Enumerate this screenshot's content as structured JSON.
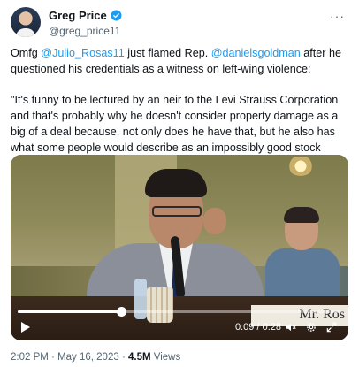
{
  "author": {
    "display_name": "Greg Price",
    "handle": "@greg_price11",
    "verified": true,
    "more_icon": "more-dots-icon"
  },
  "tweet": {
    "part1_prefix": "Omfg ",
    "mention1": "@Julio_Rosas11",
    "part1_middle": " just flamed Rep. ",
    "mention2": "@danielsgoldman",
    "part1_suffix": " after he questioned his credentials as a witness on left-wing violence:",
    "quote": "\"It's funny to be lectured by an heir to the Levi Strauss Corporation and that's probably why he doesn't consider property damage as a big of a deal because, not only does he have that, but he also has what some people would describe as an impossibly good stock portfolio.\""
  },
  "video": {
    "placard_text": "Mr. Ros",
    "time_current": "0:09",
    "time_separator": " / ",
    "time_total": "0:28",
    "progress": 0.32,
    "icons": [
      "play-icon",
      "volume-icon",
      "settings-icon",
      "fullscreen-icon"
    ]
  },
  "meta": {
    "time": "2:02 PM",
    "separator": " · ",
    "date": "May 16, 2023",
    "views_count": "4.5M",
    "views_label": " Views"
  },
  "colors": {
    "link": "#1d9bf0",
    "secondary": "#536471",
    "verified": "#1d9bf0"
  }
}
